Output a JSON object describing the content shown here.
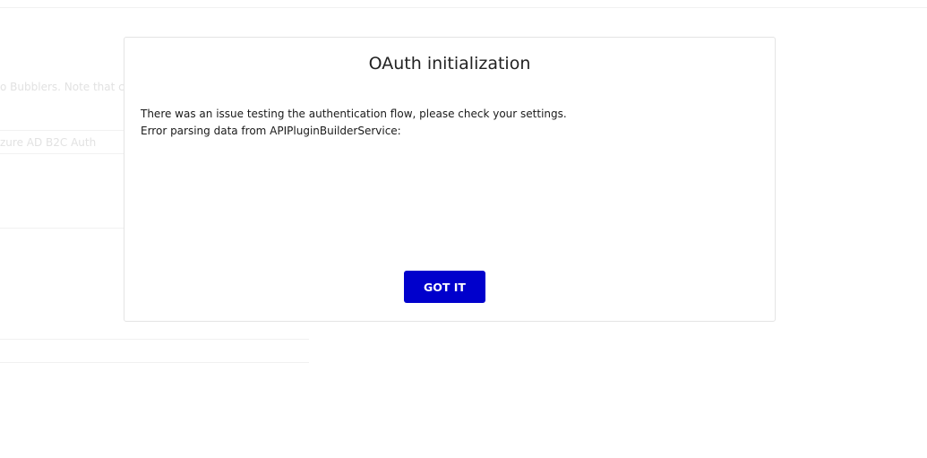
{
  "background": {
    "text_1": "o Bubblers. Note that ch",
    "text_2": "zure AD B2C Auth"
  },
  "dialog": {
    "title": "OAuth initialization",
    "message_line_1": "There was an issue testing the authentication flow, please check your settings.",
    "message_line_2": "Error parsing data from APIPluginBuilderService:",
    "button_label": "GOT IT",
    "button_color": "#0000cc"
  }
}
